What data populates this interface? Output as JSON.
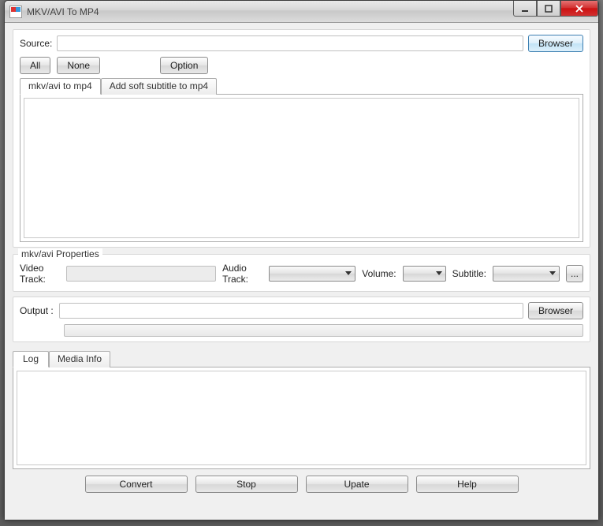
{
  "title": "MKV/AVI To MP4",
  "source": {
    "label": "Source:",
    "value": "",
    "browser": "Browser"
  },
  "toolbar": {
    "all": "All",
    "none": "None",
    "option": "Option"
  },
  "tabs": {
    "convert": "mkv/avi to mp4",
    "subtitle": "Add soft subtitle to mp4"
  },
  "properties": {
    "legend": "mkv/avi Properties",
    "video_track_label": "Video Track:",
    "video_track_value": "",
    "audio_track_label": "Audio Track:",
    "audio_track_value": "",
    "volume_label": "Volume:",
    "volume_value": "",
    "subtitle_label": "Subtitle:",
    "subtitle_value": "",
    "ellipsis": "..."
  },
  "output": {
    "label": "Output :",
    "value": "",
    "browser": "Browser"
  },
  "log_tabs": {
    "log": "Log",
    "media_info": "Media Info"
  },
  "footer": {
    "convert": "Convert",
    "stop": "Stop",
    "update": "Upate",
    "help": "Help"
  }
}
